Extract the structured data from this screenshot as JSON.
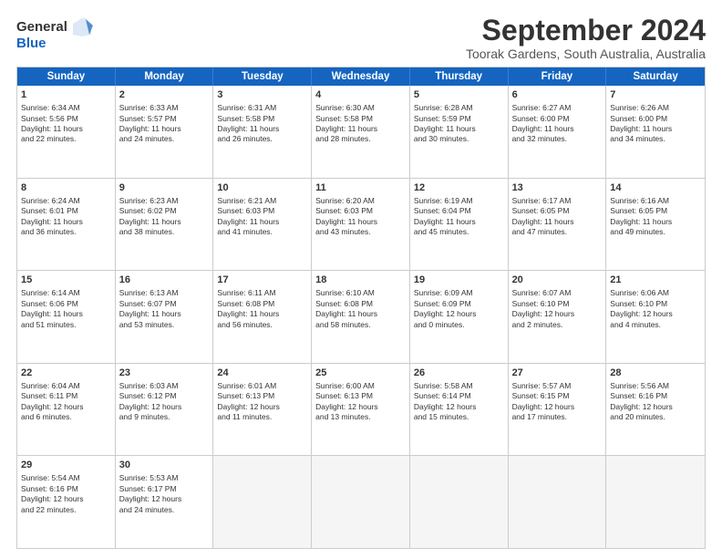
{
  "logo": {
    "general": "General",
    "blue": "Blue"
  },
  "title": "September 2024",
  "location": "Toorak Gardens, South Australia, Australia",
  "days": [
    "Sunday",
    "Monday",
    "Tuesday",
    "Wednesday",
    "Thursday",
    "Friday",
    "Saturday"
  ],
  "rows": [
    [
      {
        "day": "",
        "lines": []
      },
      {
        "day": "2",
        "lines": [
          "Sunrise: 6:33 AM",
          "Sunset: 5:57 PM",
          "Daylight: 11 hours",
          "and 24 minutes."
        ]
      },
      {
        "day": "3",
        "lines": [
          "Sunrise: 6:31 AM",
          "Sunset: 5:58 PM",
          "Daylight: 11 hours",
          "and 26 minutes."
        ]
      },
      {
        "day": "4",
        "lines": [
          "Sunrise: 6:30 AM",
          "Sunset: 5:58 PM",
          "Daylight: 11 hours",
          "and 28 minutes."
        ]
      },
      {
        "day": "5",
        "lines": [
          "Sunrise: 6:28 AM",
          "Sunset: 5:59 PM",
          "Daylight: 11 hours",
          "and 30 minutes."
        ]
      },
      {
        "day": "6",
        "lines": [
          "Sunrise: 6:27 AM",
          "Sunset: 6:00 PM",
          "Daylight: 11 hours",
          "and 32 minutes."
        ]
      },
      {
        "day": "7",
        "lines": [
          "Sunrise: 6:26 AM",
          "Sunset: 6:00 PM",
          "Daylight: 11 hours",
          "and 34 minutes."
        ]
      }
    ],
    [
      {
        "day": "8",
        "lines": [
          "Sunrise: 6:24 AM",
          "Sunset: 6:01 PM",
          "Daylight: 11 hours",
          "and 36 minutes."
        ]
      },
      {
        "day": "9",
        "lines": [
          "Sunrise: 6:23 AM",
          "Sunset: 6:02 PM",
          "Daylight: 11 hours",
          "and 38 minutes."
        ]
      },
      {
        "day": "10",
        "lines": [
          "Sunrise: 6:21 AM",
          "Sunset: 6:03 PM",
          "Daylight: 11 hours",
          "and 41 minutes."
        ]
      },
      {
        "day": "11",
        "lines": [
          "Sunrise: 6:20 AM",
          "Sunset: 6:03 PM",
          "Daylight: 11 hours",
          "and 43 minutes."
        ]
      },
      {
        "day": "12",
        "lines": [
          "Sunrise: 6:19 AM",
          "Sunset: 6:04 PM",
          "Daylight: 11 hours",
          "and 45 minutes."
        ]
      },
      {
        "day": "13",
        "lines": [
          "Sunrise: 6:17 AM",
          "Sunset: 6:05 PM",
          "Daylight: 11 hours",
          "and 47 minutes."
        ]
      },
      {
        "day": "14",
        "lines": [
          "Sunrise: 6:16 AM",
          "Sunset: 6:05 PM",
          "Daylight: 11 hours",
          "and 49 minutes."
        ]
      }
    ],
    [
      {
        "day": "15",
        "lines": [
          "Sunrise: 6:14 AM",
          "Sunset: 6:06 PM",
          "Daylight: 11 hours",
          "and 51 minutes."
        ]
      },
      {
        "day": "16",
        "lines": [
          "Sunrise: 6:13 AM",
          "Sunset: 6:07 PM",
          "Daylight: 11 hours",
          "and 53 minutes."
        ]
      },
      {
        "day": "17",
        "lines": [
          "Sunrise: 6:11 AM",
          "Sunset: 6:08 PM",
          "Daylight: 11 hours",
          "and 56 minutes."
        ]
      },
      {
        "day": "18",
        "lines": [
          "Sunrise: 6:10 AM",
          "Sunset: 6:08 PM",
          "Daylight: 11 hours",
          "and 58 minutes."
        ]
      },
      {
        "day": "19",
        "lines": [
          "Sunrise: 6:09 AM",
          "Sunset: 6:09 PM",
          "Daylight: 12 hours",
          "and 0 minutes."
        ]
      },
      {
        "day": "20",
        "lines": [
          "Sunrise: 6:07 AM",
          "Sunset: 6:10 PM",
          "Daylight: 12 hours",
          "and 2 minutes."
        ]
      },
      {
        "day": "21",
        "lines": [
          "Sunrise: 6:06 AM",
          "Sunset: 6:10 PM",
          "Daylight: 12 hours",
          "and 4 minutes."
        ]
      }
    ],
    [
      {
        "day": "22",
        "lines": [
          "Sunrise: 6:04 AM",
          "Sunset: 6:11 PM",
          "Daylight: 12 hours",
          "and 6 minutes."
        ]
      },
      {
        "day": "23",
        "lines": [
          "Sunrise: 6:03 AM",
          "Sunset: 6:12 PM",
          "Daylight: 12 hours",
          "and 9 minutes."
        ]
      },
      {
        "day": "24",
        "lines": [
          "Sunrise: 6:01 AM",
          "Sunset: 6:13 PM",
          "Daylight: 12 hours",
          "and 11 minutes."
        ]
      },
      {
        "day": "25",
        "lines": [
          "Sunrise: 6:00 AM",
          "Sunset: 6:13 PM",
          "Daylight: 12 hours",
          "and 13 minutes."
        ]
      },
      {
        "day": "26",
        "lines": [
          "Sunrise: 5:58 AM",
          "Sunset: 6:14 PM",
          "Daylight: 12 hours",
          "and 15 minutes."
        ]
      },
      {
        "day": "27",
        "lines": [
          "Sunrise: 5:57 AM",
          "Sunset: 6:15 PM",
          "Daylight: 12 hours",
          "and 17 minutes."
        ]
      },
      {
        "day": "28",
        "lines": [
          "Sunrise: 5:56 AM",
          "Sunset: 6:16 PM",
          "Daylight: 12 hours",
          "and 20 minutes."
        ]
      }
    ],
    [
      {
        "day": "29",
        "lines": [
          "Sunrise: 5:54 AM",
          "Sunset: 6:16 PM",
          "Daylight: 12 hours",
          "and 22 minutes."
        ]
      },
      {
        "day": "30",
        "lines": [
          "Sunrise: 5:53 AM",
          "Sunset: 6:17 PM",
          "Daylight: 12 hours",
          "and 24 minutes."
        ]
      },
      {
        "day": "",
        "lines": []
      },
      {
        "day": "",
        "lines": []
      },
      {
        "day": "",
        "lines": []
      },
      {
        "day": "",
        "lines": []
      },
      {
        "day": "",
        "lines": []
      }
    ]
  ],
  "row0_day1": {
    "day": "1",
    "lines": [
      "Sunrise: 6:34 AM",
      "Sunset: 5:56 PM",
      "Daylight: 11 hours",
      "and 22 minutes."
    ]
  }
}
